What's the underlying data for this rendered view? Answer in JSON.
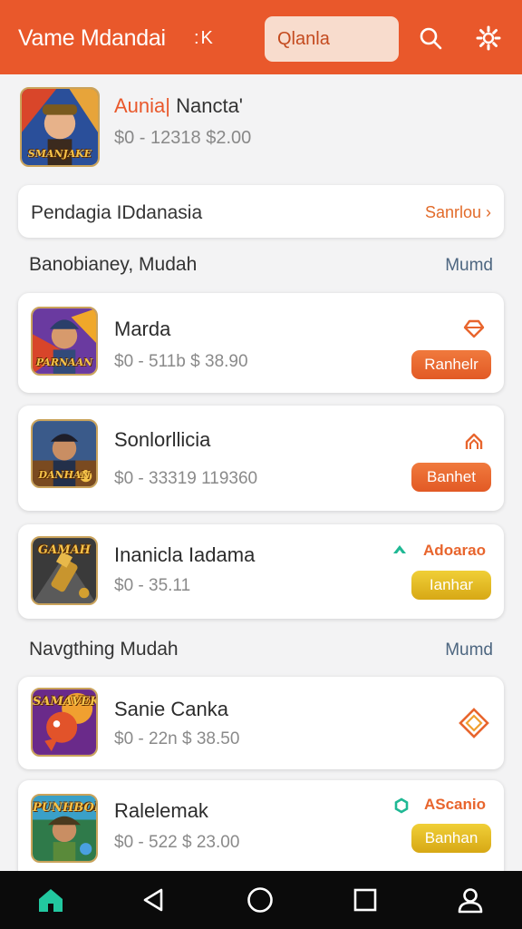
{
  "header": {
    "title": "Vame Mdandai",
    "title_icon": ":K",
    "search_text": "Qlanla",
    "icons": [
      "search-icon",
      "gear-icon"
    ]
  },
  "featured": {
    "name_accent": "Aunia|",
    "name_rest": " Nancta'",
    "price": "$0 - 12318  $2.00",
    "thumb_caption": "SMANJAKE"
  },
  "banner": {
    "text": "Pendagia IDdanasia",
    "link": "Sanrlou"
  },
  "section1": {
    "title": "Banobianey, Mudah",
    "more": "Mumd",
    "items": [
      {
        "name": "Marda",
        "price": "$0 - 511b $ 38.90",
        "button": "Ranhelr",
        "caption": "PARNAAN",
        "icon": "diamond-outline-icon"
      },
      {
        "name": "Sonlorllicia",
        "price": "$0 - 33319  119360",
        "button": "Banhet",
        "caption": "DANHAN",
        "icon": "upgrade-outline-icon"
      },
      {
        "name": "Inanicla Iadama",
        "price": "$0 - 35.11",
        "tag": "Adoarao",
        "button": "Ianhar",
        "caption": "GAMAH",
        "icon": "trend-up-icon"
      }
    ]
  },
  "section2": {
    "title": "Navgthing Mudah",
    "more": "Mumd",
    "items": [
      {
        "name": "Sanie Canka",
        "price": "$0 - 22n $ 38.50",
        "caption": "SAMAVEK",
        "icon": "diamond-badge-icon"
      },
      {
        "name": "Ralelemak",
        "price": "$0 - 522  $ 23.00",
        "tag": "AScanio",
        "button": "Banhan",
        "caption": "PUNHBON",
        "icon": "hexagon-icon"
      }
    ]
  },
  "colors": {
    "brand": "#e9582b",
    "button_orange": "#e8652d",
    "button_yellow": "#e3bd22",
    "trend_green": "#1fb894"
  },
  "navbar": {
    "icons": [
      "home-icon",
      "back-icon",
      "home-circle-icon",
      "recents-icon",
      "profile-icon"
    ]
  }
}
